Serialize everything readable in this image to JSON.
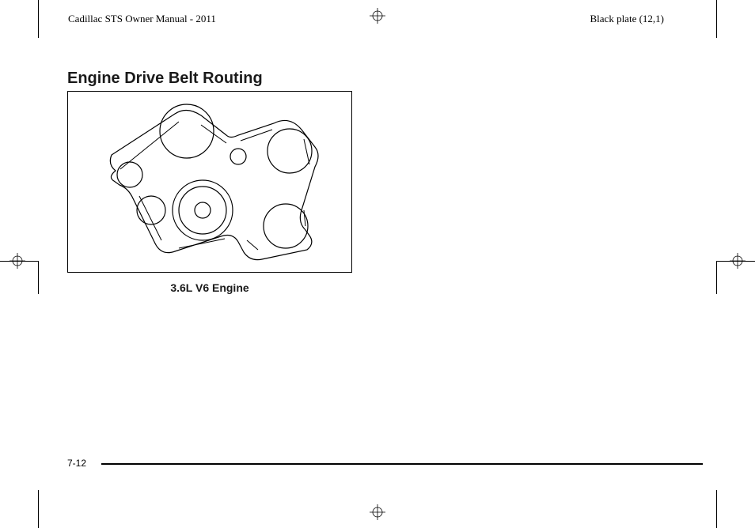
{
  "header": {
    "left": "Cadillac STS Owner Manual - 2011",
    "right": "Black plate (12,1)"
  },
  "section": {
    "heading": "Engine Drive Belt Routing",
    "caption": "3.6L V6 Engine"
  },
  "page_number": "7-12"
}
